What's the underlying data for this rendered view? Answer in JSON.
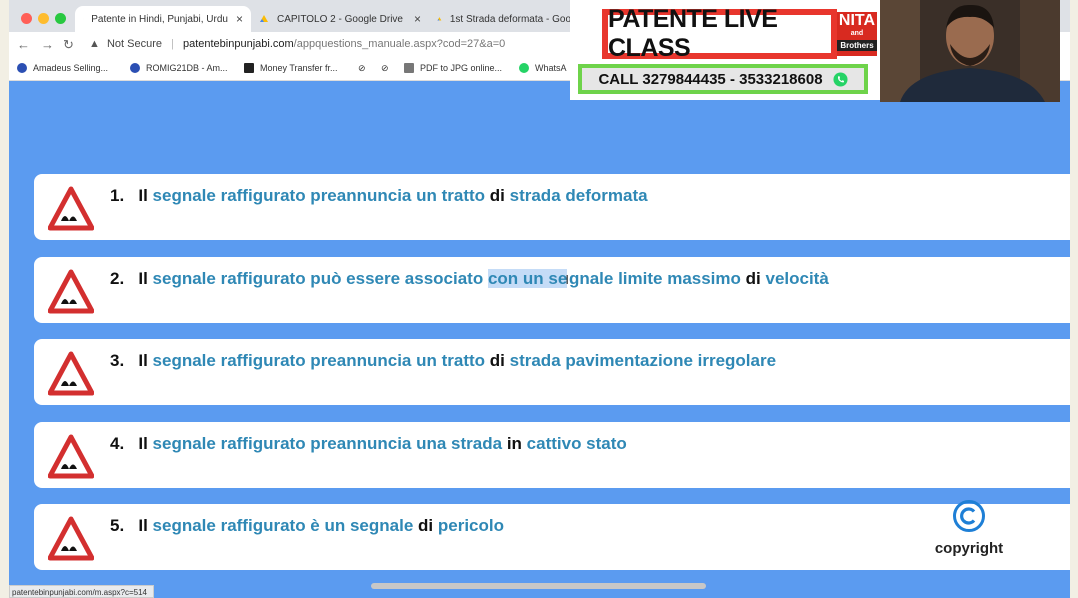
{
  "browser": {
    "tabs": [
      {
        "title": "Patente in Hindi, Punjabi, Urdu",
        "close": "×"
      },
      {
        "title": "CAPITOLO 2 - Google Drive",
        "close": "×"
      },
      {
        "title": "1st Strada deformata - Goo"
      }
    ],
    "address": {
      "security_label": "Not Secure",
      "domain": "patentebinpunjabi.com",
      "path": "/appquestions_manuale.aspx?cod=27&a=0"
    },
    "bookmarks": [
      "Amadeus Selling...",
      "ROMIG21DB - Am...",
      "Money Transfer fr...",
      "PDF to JPG online...",
      "WhatsA"
    ],
    "status_url": "patentebinpunjabi.com/m.aspx?c=514"
  },
  "banner": {
    "title": "PATENTE LIVE CLASS",
    "brand_line1": "NITA",
    "brand_line2": "and",
    "brand_line3": "Brothers",
    "call": "CALL 3279844435 - 3533218608"
  },
  "questions": [
    {
      "num": "1.",
      "il": "Il",
      "a": "segnale raffigurato preannuncia un tratto",
      "conn": "di",
      "b": "strada deformata"
    },
    {
      "num": "2.",
      "il": "Il",
      "a": "segnale raffigurato può essere associato",
      "hl1": "con un se",
      "hl2": "gnale",
      "a2": "limite massimo",
      "conn": "di",
      "b": "velocità"
    },
    {
      "num": "3.",
      "il": "Il",
      "a": "segnale raffigurato preannuncia un tratto",
      "conn": "di",
      "b": "strada pavimentazione irregolare"
    },
    {
      "num": "4.",
      "il": "Il",
      "a": "segnale raffigurato preannuncia una strada",
      "conn": "in",
      "b": "cattivo stato"
    },
    {
      "num": "5.",
      "il": "Il",
      "a": "segnale raffigurato è un segnale",
      "conn": "di",
      "b": "pericolo"
    }
  ],
  "copyright_label": "copyright",
  "colors": {
    "accent": "#5b9bf0",
    "question_blue": "#2f88b5",
    "sign_red": "#d32f2f",
    "banner_red": "#e8362d",
    "banner_green": "#6ed34a"
  }
}
